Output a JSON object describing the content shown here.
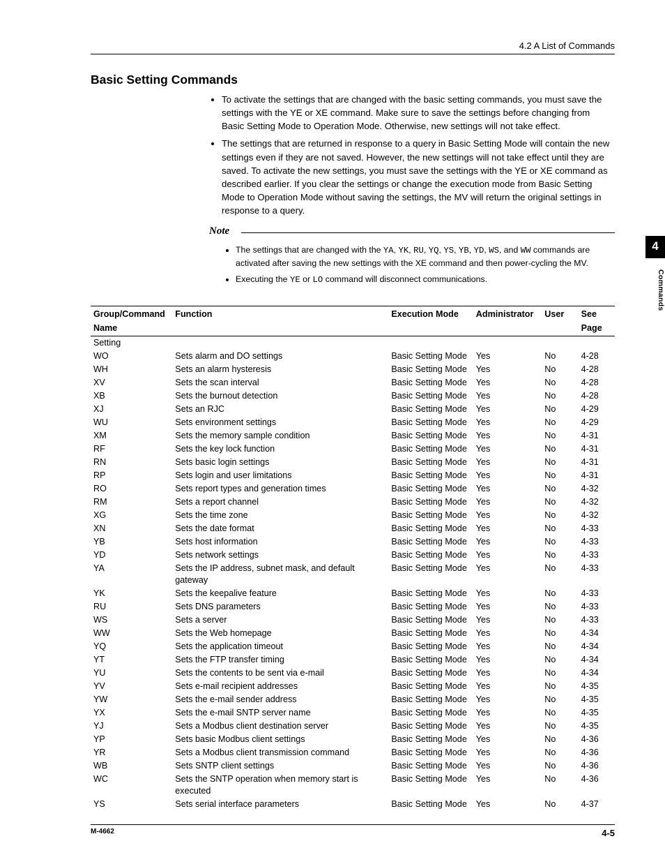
{
  "header": {
    "section_ref": "4.2  A List of Commands"
  },
  "title": "Basic Setting Commands",
  "bullets": [
    "To activate the settings that are changed with the basic setting commands, you must save the settings with the YE or XE command. Make sure to save the settings before changing from Basic Setting Mode to Operation Mode. Otherwise, new settings will not take effect.",
    "The settings that are returned in response to a query in Basic Setting Mode will contain the new settings even if they are not saved. However, the new settings will not take effect until they are saved. To activate the new settings, you must save the settings with the YE or XE command as described earlier. If you clear the settings or change the execution mode from Basic Setting Mode to Operation Mode without saving the settings, the MV will return the original settings in response to a query."
  ],
  "note": {
    "heading": "Note",
    "item1_pre": "The settings that are changed with the ",
    "item1_codes": [
      "YA",
      "YK",
      "RU",
      "YQ",
      "YS",
      "YB",
      "YD",
      "WS"
    ],
    "item1_and": ", and ",
    "item1_lastcode": "WW",
    "item1_post": " commands are activated after saving the new settings with the XE command and then power-cycling the MV.",
    "item2_pre": "Executing the ",
    "item2_code1": "YE",
    "item2_or": " or ",
    "item2_code2": "LO",
    "item2_post": " command will disconnect communications."
  },
  "table": {
    "head": {
      "name_l1": "Group/Command",
      "name_l2": "Name",
      "func": "Function",
      "mode": "Execution Mode",
      "admin": "Administrator",
      "user": "User",
      "page_l1": "See",
      "page_l2": "Page"
    },
    "group_label": "Setting",
    "rows": [
      {
        "name": "WO",
        "func": "Sets alarm and DO settings",
        "mode": "Basic Setting Mode",
        "admin": "Yes",
        "user": "No",
        "page": "4-28"
      },
      {
        "name": "WH",
        "func": "Sets an alarm hysteresis",
        "mode": "Basic Setting Mode",
        "admin": "Yes",
        "user": "No",
        "page": "4-28"
      },
      {
        "name": "XV",
        "func": "Sets the scan interval",
        "mode": "Basic Setting Mode",
        "admin": "Yes",
        "user": "No",
        "page": "4-28"
      },
      {
        "name": "XB",
        "func": "Sets the burnout detection",
        "mode": "Basic Setting Mode",
        "admin": "Yes",
        "user": "No",
        "page": "4-28"
      },
      {
        "name": "XJ",
        "func": "Sets an RJC",
        "mode": "Basic Setting Mode",
        "admin": "Yes",
        "user": "No",
        "page": "4-29"
      },
      {
        "name": "WU",
        "func": "Sets environment settings",
        "mode": "Basic Setting Mode",
        "admin": "Yes",
        "user": "No",
        "page": "4-29"
      },
      {
        "name": "XM",
        "func": "Sets the memory sample condition",
        "mode": "Basic Setting Mode",
        "admin": "Yes",
        "user": "No",
        "page": "4-31"
      },
      {
        "name": "RF",
        "func": "Sets the key lock function",
        "mode": "Basic Setting Mode",
        "admin": "Yes",
        "user": "No",
        "page": "4-31"
      },
      {
        "name": "RN",
        "func": "Sets basic login settings",
        "mode": "Basic Setting Mode",
        "admin": "Yes",
        "user": "No",
        "page": "4-31"
      },
      {
        "name": "RP",
        "func": "Sets login and user limitations",
        "mode": "Basic Setting Mode",
        "admin": "Yes",
        "user": "No",
        "page": "4-31"
      },
      {
        "name": "RO",
        "func": "Sets report types and generation times",
        "mode": "Basic Setting Mode",
        "admin": "Yes",
        "user": "No",
        "page": "4-32"
      },
      {
        "name": "RM",
        "func": "Sets a report channel",
        "mode": "Basic Setting Mode",
        "admin": "Yes",
        "user": "No",
        "page": "4-32"
      },
      {
        "name": "XG",
        "func": "Sets the time zone",
        "mode": "Basic Setting Mode",
        "admin": "Yes",
        "user": "No",
        "page": "4-32"
      },
      {
        "name": "XN",
        "func": "Sets the date format",
        "mode": "Basic Setting Mode",
        "admin": "Yes",
        "user": "No",
        "page": "4-33"
      },
      {
        "name": "YB",
        "func": "Sets host information",
        "mode": "Basic Setting Mode",
        "admin": "Yes",
        "user": "No",
        "page": "4-33"
      },
      {
        "name": "YD",
        "func": "Sets network settings",
        "mode": "Basic Setting Mode",
        "admin": "Yes",
        "user": "No",
        "page": "4-33"
      },
      {
        "name": "YA",
        "func": "Sets the IP address, subnet mask, and default gateway",
        "mode": "Basic Setting Mode",
        "admin": "Yes",
        "user": "No",
        "page": "4-33"
      },
      {
        "name": "YK",
        "func": "Sets the keepalive feature",
        "mode": "Basic Setting Mode",
        "admin": "Yes",
        "user": "No",
        "page": "4-33"
      },
      {
        "name": "RU",
        "func": "Sets DNS parameters",
        "mode": "Basic Setting Mode",
        "admin": "Yes",
        "user": "No",
        "page": "4-33"
      },
      {
        "name": "WS",
        "func": "Sets a server",
        "mode": "Basic Setting Mode",
        "admin": "Yes",
        "user": "No",
        "page": "4-33"
      },
      {
        "name": "WW",
        "func": "Sets the Web homepage",
        "mode": "Basic Setting Mode",
        "admin": "Yes",
        "user": "No",
        "page": "4-34"
      },
      {
        "name": "YQ",
        "func": "Sets the application timeout",
        "mode": "Basic Setting Mode",
        "admin": "Yes",
        "user": "No",
        "page": "4-34"
      },
      {
        "name": "YT",
        "func": "Sets the FTP transfer timing",
        "mode": "Basic Setting Mode",
        "admin": "Yes",
        "user": "No",
        "page": "4-34"
      },
      {
        "name": "YU",
        "func": "Sets the contents to be sent via e-mail",
        "mode": "Basic Setting Mode",
        "admin": "Yes",
        "user": "No",
        "page": "4-34"
      },
      {
        "name": "YV",
        "func": "Sets e-mail recipient addresses",
        "mode": "Basic Setting Mode",
        "admin": "Yes",
        "user": "No",
        "page": "4-35"
      },
      {
        "name": "YW",
        "func": "Sets the e-mail sender address",
        "mode": "Basic Setting Mode",
        "admin": "Yes",
        "user": "No",
        "page": "4-35"
      },
      {
        "name": "YX",
        "func": "Sets the e-mail SNTP server name",
        "mode": "Basic Setting Mode",
        "admin": "Yes",
        "user": "No",
        "page": "4-35"
      },
      {
        "name": "YJ",
        "func": "Sets a Modbus client destination server",
        "mode": "Basic Setting Mode",
        "admin": "Yes",
        "user": "No",
        "page": "4-35"
      },
      {
        "name": "YP",
        "func": "Sets basic Modbus client settings",
        "mode": "Basic Setting Mode",
        "admin": "Yes",
        "user": "No",
        "page": "4-36"
      },
      {
        "name": "YR",
        "func": "Sets a Modbus client transmission command",
        "mode": "Basic Setting Mode",
        "admin": "Yes",
        "user": "No",
        "page": "4-36"
      },
      {
        "name": "WB",
        "func": "Sets SNTP client settings",
        "mode": "Basic Setting Mode",
        "admin": "Yes",
        "user": "No",
        "page": "4-36"
      },
      {
        "name": "WC",
        "func": "Sets the SNTP operation when memory start is executed",
        "mode": "Basic Setting Mode",
        "admin": "Yes",
        "user": "No",
        "page": "4-36"
      },
      {
        "name": "YS",
        "func": "Sets serial interface parameters",
        "mode": "Basic Setting Mode",
        "admin": "Yes",
        "user": "No",
        "page": "4-37"
      }
    ]
  },
  "sidetab": {
    "chapter": "4",
    "label": "Commands"
  },
  "footer": {
    "docnum": "M-4662",
    "pagenum": "4-5"
  }
}
